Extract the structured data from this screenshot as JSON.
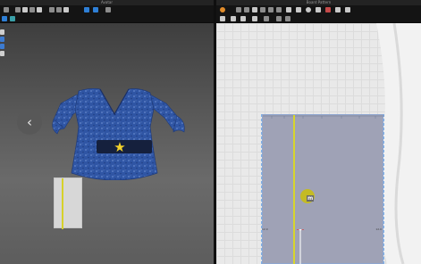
{
  "window_3d": {
    "title": "Avatar",
    "toolbar_icons": [
      "select-icon",
      "move-icon",
      "rotate-icon",
      "fold-icon",
      "pin-icon",
      "measure-icon",
      "sewing-icon",
      "simulate-icon",
      "avatar-icon",
      "camera-icon",
      "texture-icon"
    ],
    "side_icons": [
      "fabric-icon",
      "button-icon",
      "layer-icon",
      "settings-icon"
    ],
    "nav_prev_label": "‹",
    "garment": {
      "type": "blouse",
      "fabric_color": "#2f55a4",
      "belt_color": "#15203d",
      "star_color": "#f3d22b",
      "star": "★"
    }
  },
  "window_2d": {
    "title": "Board Pattern",
    "toolbar_icons": [
      "transform-icon",
      "edit-point-icon",
      "curve-icon",
      "segment-icon",
      "polygon-icon",
      "rectangle-icon",
      "circle-icon",
      "dart-icon",
      "notch-icon",
      "seam-icon",
      "grading-icon"
    ],
    "pattern": {
      "fabric_color": "#9fa2b6",
      "grain_color": "#d7d52c",
      "pin_label": "m",
      "left_label": "12.0",
      "right_label": "12.0"
    }
  },
  "colors": {
    "selected_tool": "#2e7fd6",
    "grainline": "#d7d52c"
  }
}
